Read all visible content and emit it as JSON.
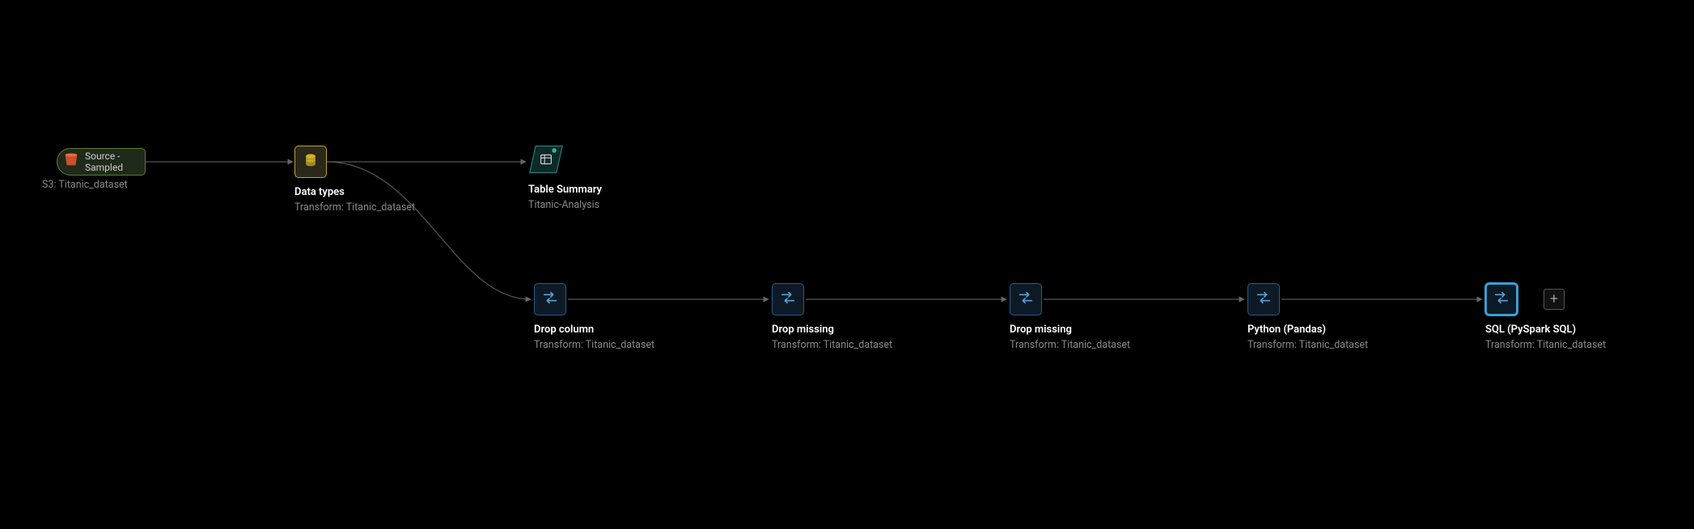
{
  "nodes": {
    "source": {
      "label": "Source - Sampled",
      "sub": "S3: Titanic_dataset"
    },
    "types": {
      "title": "Data types",
      "sub": "Transform: Titanic_dataset"
    },
    "summary": {
      "title": "Table Summary",
      "sub": "Titanic-Analysis"
    },
    "dropcol": {
      "title": "Drop column",
      "sub": "Transform: Titanic_dataset"
    },
    "dropmiss1": {
      "title": "Drop missing",
      "sub": "Transform: Titanic_dataset"
    },
    "dropmiss2": {
      "title": "Drop missing",
      "sub": "Transform: Titanic_dataset"
    },
    "python": {
      "title": "Python (Pandas)",
      "sub": "Transform: Titanic_dataset"
    },
    "sql": {
      "title": "SQL (PySpark SQL)",
      "sub": "Transform: Titanic_dataset"
    }
  },
  "add_label": "+"
}
